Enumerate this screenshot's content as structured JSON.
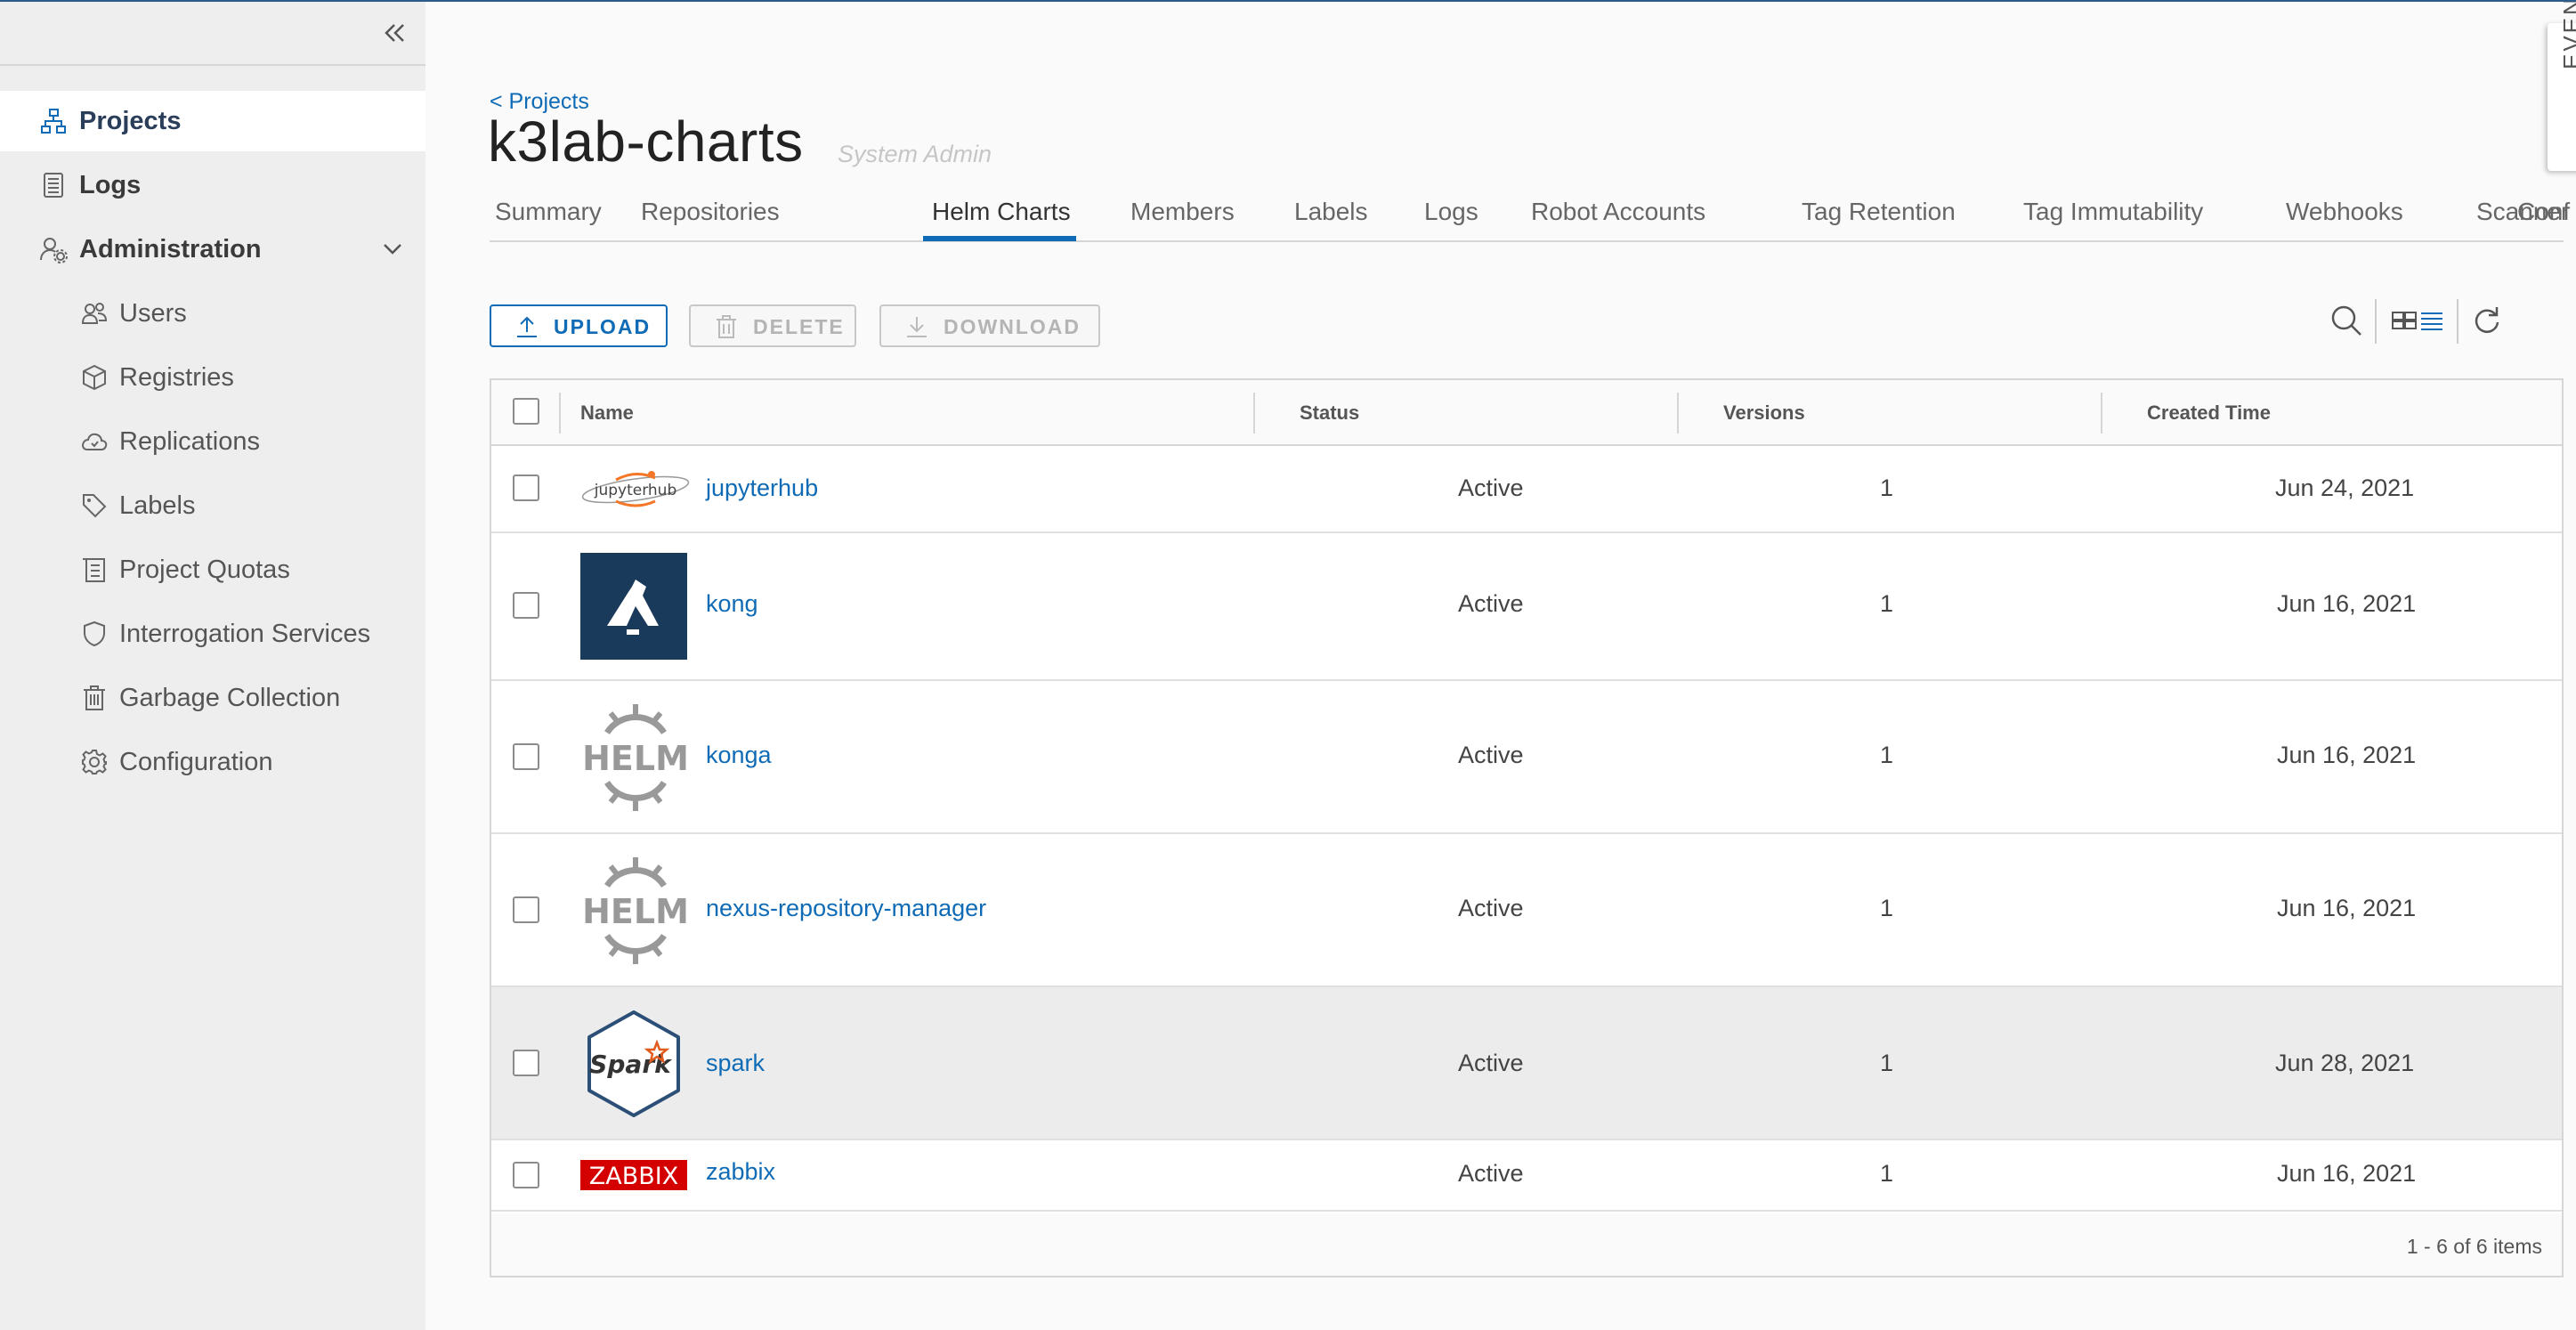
{
  "sidebar": {
    "items": [
      {
        "label": "Projects",
        "icon": "projects-icon"
      },
      {
        "label": "Logs",
        "icon": "logs-icon"
      },
      {
        "label": "Administration",
        "icon": "administration-icon"
      },
      {
        "label": "Users",
        "icon": "users-icon"
      },
      {
        "label": "Registries",
        "icon": "registries-icon"
      },
      {
        "label": "Replications",
        "icon": "replications-icon"
      },
      {
        "label": "Labels",
        "icon": "labels-icon"
      },
      {
        "label": "Project Quotas",
        "icon": "project-quotas-icon"
      },
      {
        "label": "Interrogation Services",
        "icon": "shield-icon"
      },
      {
        "label": "Garbage Collection",
        "icon": "trash-icon"
      },
      {
        "label": "Configuration",
        "icon": "gear-icon"
      }
    ]
  },
  "header": {
    "breadcrumb": "< Projects",
    "title": "k3lab-charts",
    "role": "System Admin",
    "event_tab": "EVENT"
  },
  "tabs": [
    {
      "label": "Summary"
    },
    {
      "label": "Repositories"
    },
    {
      "label": "Helm Charts",
      "active": true
    },
    {
      "label": "Members"
    },
    {
      "label": "Labels"
    },
    {
      "label": "Logs"
    },
    {
      "label": "Robot Accounts"
    },
    {
      "label": "Tag Retention"
    },
    {
      "label": "Tag Immutability"
    },
    {
      "label": "Webhooks"
    },
    {
      "label": "Scanner"
    },
    {
      "label": "Conf"
    }
  ],
  "toolbar": {
    "upload_label": "UPLOAD",
    "delete_label": "DELETE",
    "download_label": "DOWNLOAD"
  },
  "table": {
    "columns": [
      "Name",
      "Status",
      "Versions",
      "Created Time"
    ],
    "rows": [
      {
        "name": "jupyterhub",
        "status": "Active",
        "versions": "1",
        "created": "Jun 24, 2021",
        "logo": "jupyterhub-logo",
        "logo_text": "jupyterhub"
      },
      {
        "name": "kong",
        "status": "Active",
        "versions": "1",
        "created": "Jun 16, 2021",
        "logo": "kong-logo"
      },
      {
        "name": "konga",
        "status": "Active",
        "versions": "1",
        "created": "Jun 16, 2021",
        "logo": "helm-logo",
        "logo_text": "HELM"
      },
      {
        "name": "nexus-repository-manager",
        "status": "Active",
        "versions": "1",
        "created": "Jun 16, 2021",
        "logo": "helm-logo",
        "logo_text": "HELM"
      },
      {
        "name": "spark",
        "status": "Active",
        "versions": "1",
        "created": "Jun 28, 2021",
        "logo": "spark-logo",
        "logo_text": "Spark"
      },
      {
        "name": "zabbix",
        "status": "Active",
        "versions": "1",
        "created": "Jun 16, 2021",
        "logo": "zabbix-logo",
        "logo_text": "ZABBIX"
      }
    ],
    "footer": "1 - 6 of 6 items"
  },
  "colors": {
    "accent": "#0f6bb5",
    "sidebar_bg": "#eeeeee",
    "zabbix_red": "#d40000",
    "kong_blue": "#1a3a5c"
  }
}
